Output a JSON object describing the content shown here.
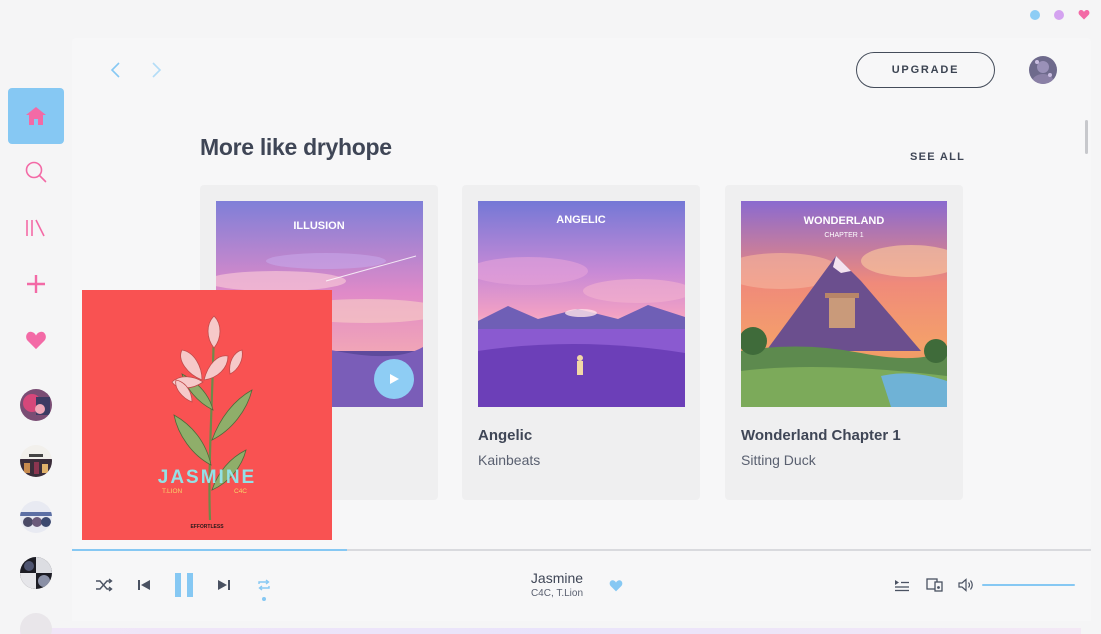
{
  "window": {
    "dots": [
      "blue-dot",
      "purple-dot",
      "heart-icon"
    ]
  },
  "sidebar": {
    "items": [
      {
        "name": "home",
        "icon": "home-icon",
        "active": true
      },
      {
        "name": "search",
        "icon": "search-icon"
      },
      {
        "name": "library",
        "icon": "library-icon"
      },
      {
        "name": "create",
        "icon": "plus-icon"
      },
      {
        "name": "liked",
        "icon": "heart-icon"
      }
    ],
    "recent_covers": 5
  },
  "header": {
    "back_icon": "chevron-left-icon",
    "forward_icon": "chevron-right-icon",
    "upgrade_label": "UPGRADE"
  },
  "section": {
    "title": "More like dryhope",
    "see_all_label": "SEE ALL",
    "cards": [
      {
        "cover_text": "ILLUSION",
        "title": "",
        "subtitle": ""
      },
      {
        "cover_text": "ANGELIC",
        "title": "Angelic",
        "subtitle": "Kainbeats"
      },
      {
        "cover_text": "WONDERLAND",
        "cover_subtext": "CHAPTER 1",
        "title": "Wonderland Chapter 1",
        "subtitle": "Sitting Duck"
      }
    ]
  },
  "now_playing_art": {
    "title_text": "JASMINE",
    "artist_left": "T.LION",
    "artist_right": "C4C",
    "label_text": "EFFORTLESS"
  },
  "player": {
    "track_title": "Jasmine",
    "track_artist": "C4C, T.Lion",
    "progress": 0.27,
    "volume": 1.0,
    "repeat_active": true,
    "liked": true,
    "colors": {
      "accent": "#86c8f3",
      "pink": "#f36aa6"
    }
  }
}
